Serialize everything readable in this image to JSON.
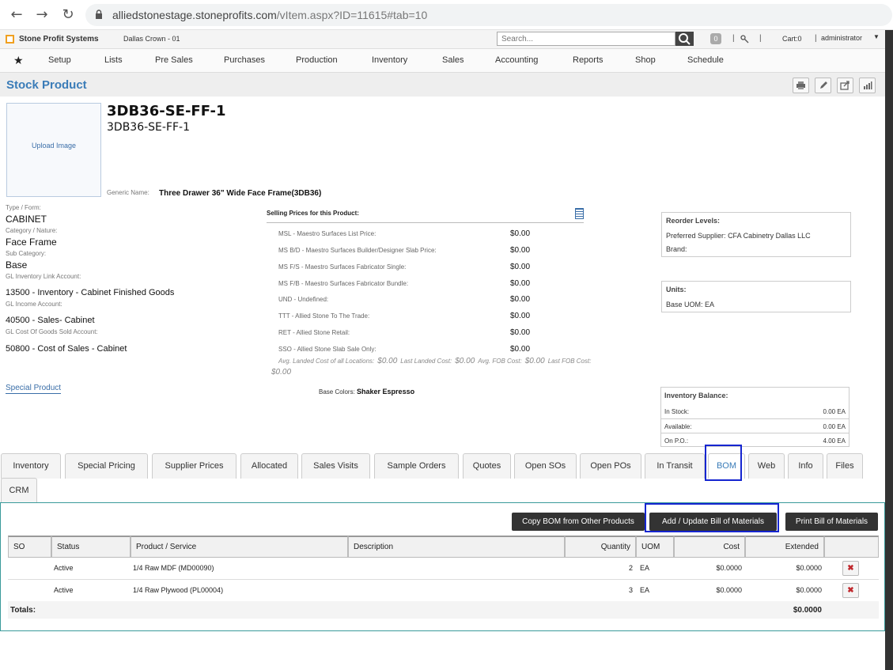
{
  "browser": {
    "url_host": "alliedstonestage.stoneprofits.com",
    "url_path": "/vItem.aspx?ID=11615#tab=10"
  },
  "header": {
    "brand": "Stone Profit Systems",
    "location": "Dallas Crown - 01",
    "search_placeholder": "Search...",
    "notifications": "0",
    "cart": "Cart:0",
    "user": "administrator"
  },
  "menu": [
    "Setup",
    "Lists",
    "Pre Sales",
    "Purchases",
    "Production",
    "Inventory",
    "Sales",
    "Accounting",
    "Reports",
    "Shop",
    "Schedule"
  ],
  "page": {
    "title": "Stock Product"
  },
  "product": {
    "upload_label": "Upload Image",
    "name": "3DB36-SE-FF-1",
    "subname": "3DB36-SE-FF-1",
    "generic_label": "Generic Name:",
    "generic_value": "Three Drawer 36\" Wide Face Frame(3DB36)"
  },
  "fields": {
    "type_label": "Type / Form:",
    "type_value": "CABINET",
    "category_label": "Category / Nature:",
    "category_value": "Face Frame",
    "subcat_label": "Sub Category:",
    "subcat_value": "Base",
    "gl_inv_label": "GL Inventory Link Account:",
    "gl_inv_value": "13500 - Inventory - Cabinet Finished Goods",
    "gl_inc_label": "GL Income Account:",
    "gl_inc_value": "40500 - Sales- Cabinet",
    "gl_cogs_label": "GL Cost Of Goods Sold Account:",
    "gl_cogs_value": "50800 - Cost of Sales - Cabinet",
    "special_link": "Special Product"
  },
  "selling_prices": {
    "title": "Selling Prices for this Product:",
    "rows": [
      {
        "label": "MSL - Maestro Surfaces List Price:",
        "value": "$0.00"
      },
      {
        "label": "MS B/D - Maestro Surfaces Builder/Designer Slab Price:",
        "value": "$0.00"
      },
      {
        "label": "MS F/S - Maestro Surfaces Fabricator Single:",
        "value": "$0.00"
      },
      {
        "label": "MS F/B - Maestro Surfaces Fabricator Bundle:",
        "value": "$0.00"
      },
      {
        "label": "UND - Undefined:",
        "value": "$0.00"
      },
      {
        "label": "TTT - Allied Stone To The Trade:",
        "value": "$0.00"
      },
      {
        "label": "RET - Allied Stone Retail:",
        "value": "$0.00"
      },
      {
        "label": "SSO - Allied Stone Slab Sale Only:",
        "value": "$0.00"
      }
    ],
    "avg_landed_label": "Avg. Landed Cost of all Locations:",
    "avg_landed_value": "$0.00",
    "last_landed_label": "Last Landed Cost:",
    "last_landed_value": "$0.00",
    "avg_fob_label": "Avg. FOB Cost:",
    "avg_fob_value": "$0.00",
    "last_fob_label": "Last FOB Cost:",
    "last_fob_value": "$0.00",
    "base_colors_label": "Base Colors:",
    "base_colors_value": "Shaker Espresso"
  },
  "reorder": {
    "title": "Reorder Levels:",
    "supplier_label": "Preferred Supplier:",
    "supplier_value": "CFA Cabinetry Dallas LLC",
    "brand_label": "Brand:"
  },
  "units": {
    "title": "Units:",
    "base_uom_label": "Base UOM:",
    "base_uom_value": "EA"
  },
  "inventory_balance": {
    "title": "Inventory Balance:",
    "rows": [
      {
        "label": "In Stock:",
        "value": "0.00 EA"
      },
      {
        "label": "Available:",
        "value": "0.00 EA"
      },
      {
        "label": "On P.O.:",
        "value": "4.00 EA"
      }
    ]
  },
  "tabs": [
    "Inventory",
    "Special Pricing",
    "Supplier Prices",
    "Allocated",
    "Sales Visits",
    "Sample Orders",
    "Quotes",
    "Open SOs",
    "Open POs",
    "In Transit",
    "BOM",
    "Web",
    "Info",
    "Files",
    "CRM"
  ],
  "bom": {
    "buttons": {
      "copy": "Copy BOM from Other Products",
      "add": "Add / Update Bill of Materials",
      "print": "Print Bill of Materials"
    },
    "columns": [
      "SO",
      "Status",
      "Product / Service",
      "Description",
      "Quantity",
      "UOM",
      "Cost",
      "Extended"
    ],
    "rows": [
      {
        "so": "",
        "status": "Active",
        "product": "1/4 Raw MDF (MD00090)",
        "description": "",
        "quantity": "2",
        "uom": "EA",
        "cost": "$0.0000",
        "extended": "$0.0000"
      },
      {
        "so": "",
        "status": "Active",
        "product": "1/4 Raw Plywood (PL00004)",
        "description": "",
        "quantity": "3",
        "uom": "EA",
        "cost": "$0.0000",
        "extended": "$0.0000"
      }
    ],
    "totals_label": "Totals:",
    "totals_value": "$0.0000"
  }
}
